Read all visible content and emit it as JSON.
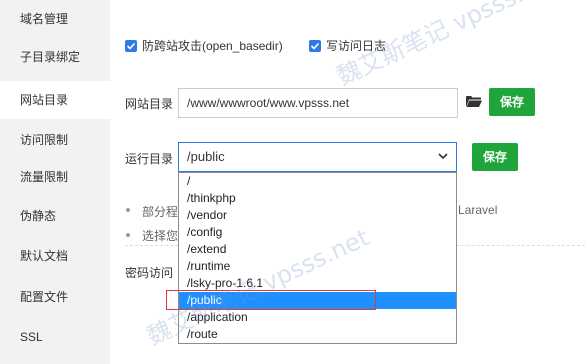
{
  "sidebar": {
    "items": [
      {
        "label": "域名管理"
      },
      {
        "label": "子目录绑定"
      },
      {
        "label": "网站目录"
      },
      {
        "label": "访问限制"
      },
      {
        "label": "流量限制"
      },
      {
        "label": "伪静态"
      },
      {
        "label": "默认文档"
      },
      {
        "label": "配置文件"
      },
      {
        "label": "SSL"
      }
    ],
    "active_index": 2
  },
  "options": {
    "anti_cross_label": "防跨站攻击(open_basedir)",
    "access_log_label": "写访问日志"
  },
  "site_dir": {
    "label": "网站目录",
    "value": "/www/wwwroot/www.vpsss.net",
    "save_label": "保存"
  },
  "run_dir": {
    "label": "运行目录",
    "value": "/public",
    "save_label": "保存",
    "options": [
      "/",
      "/thinkphp",
      "/vendor",
      "/config",
      "/extend",
      "/runtime",
      "/lsky-pro-1.6.1",
      "/public",
      "/application",
      "/route"
    ],
    "selected_index": 7
  },
  "notes": {
    "note1_prefix": "部分程",
    "note1_suffix": "Laravel",
    "note2_prefix": "选择您"
  },
  "password_access": {
    "label": "密码访问"
  },
  "watermark": "魏艾斯笔记 vpsss.net"
}
